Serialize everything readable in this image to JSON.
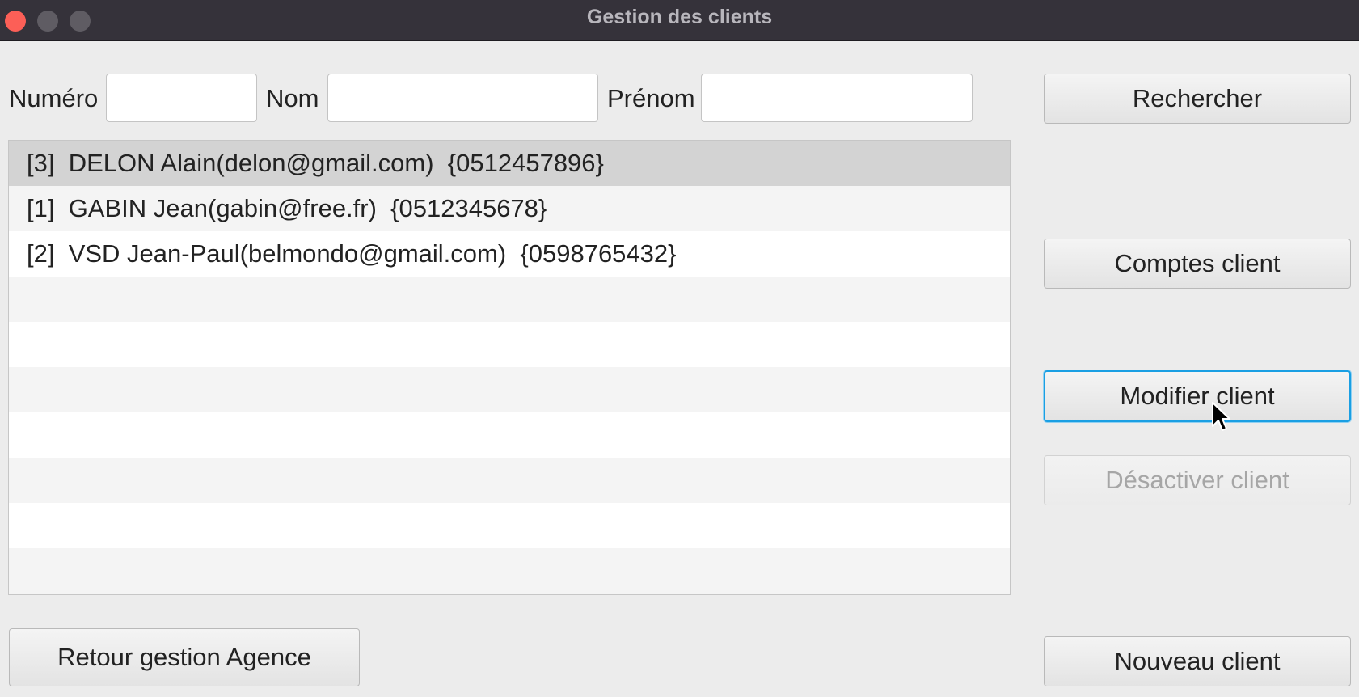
{
  "window": {
    "title": "Gestion des clients"
  },
  "search": {
    "numero_label": "Numéro",
    "numero_value": "",
    "nom_label": "Nom",
    "nom_value": "",
    "prenom_label": "Prénom",
    "prenom_value": ""
  },
  "buttons": {
    "rechercher": "Rechercher",
    "comptes_client": "Comptes client",
    "modifier_client": "Modifier client",
    "desactiver_client": "Désactiver client",
    "nouveau_client": "Nouveau client",
    "retour": "Retour gestion Agence"
  },
  "clients": [
    {
      "text": "[3]  DELON Alain(delon@gmail.com)  {0512457896}",
      "selected": true
    },
    {
      "text": "[1]  GABIN Jean(gabin@free.fr)  {0512345678}",
      "selected": false
    },
    {
      "text": "[2]  VSD Jean-Paul(belmondo@gmail.com)  {0598765432}",
      "selected": false
    }
  ]
}
